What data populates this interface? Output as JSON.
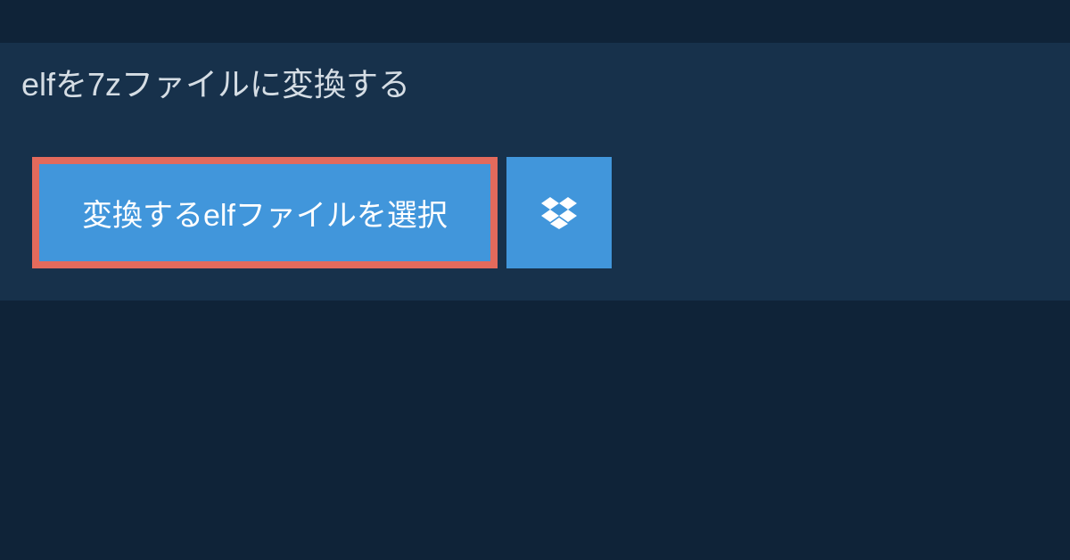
{
  "title": "elfを7zファイルに変換する",
  "select_button_label": "変換するelfファイルを選択"
}
